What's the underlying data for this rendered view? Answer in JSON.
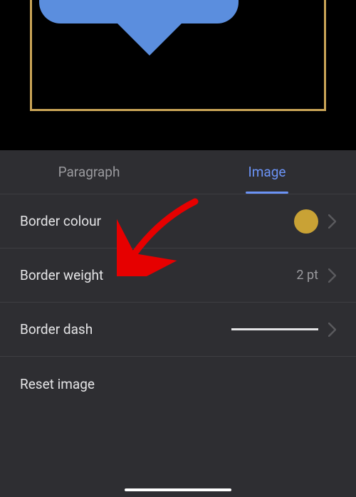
{
  "tabs": {
    "paragraph": "Paragraph",
    "image": "Image"
  },
  "options": {
    "border_colour": {
      "label": "Border colour",
      "color": "#c9a235"
    },
    "border_weight": {
      "label": "Border weight",
      "value": "2 pt"
    },
    "border_dash": {
      "label": "Border dash"
    },
    "reset_image": {
      "label": "Reset image"
    }
  }
}
